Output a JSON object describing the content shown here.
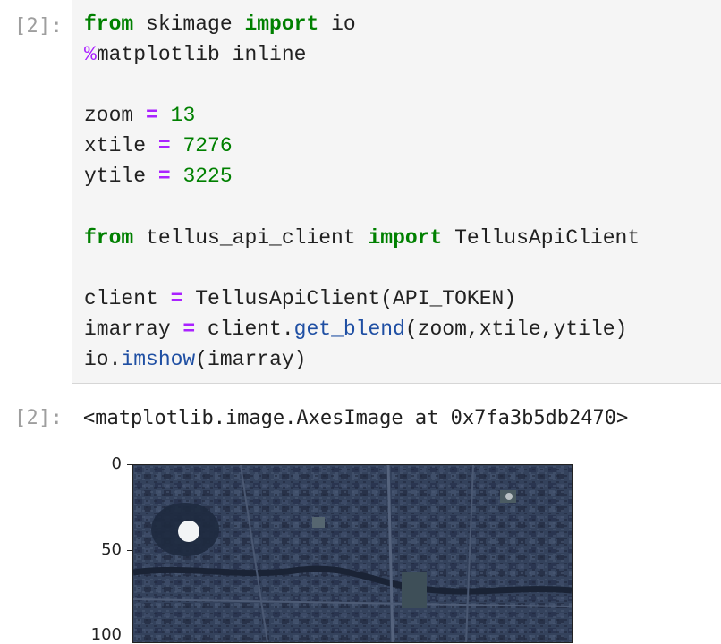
{
  "input_cell": {
    "prompt": "[2]:",
    "lines": [
      [
        {
          "t": "from",
          "c": "kw"
        },
        {
          "t": " skimage ",
          "c": ""
        },
        {
          "t": "import",
          "c": "kw"
        },
        {
          "t": " io",
          "c": ""
        }
      ],
      [
        {
          "t": "%",
          "c": "magic"
        },
        {
          "t": "matplotlib inline",
          "c": ""
        }
      ],
      [],
      [
        {
          "t": "zoom ",
          "c": ""
        },
        {
          "t": "=",
          "c": "op"
        },
        {
          "t": " ",
          "c": ""
        },
        {
          "t": "13",
          "c": "num"
        }
      ],
      [
        {
          "t": "xtile ",
          "c": ""
        },
        {
          "t": "=",
          "c": "op"
        },
        {
          "t": " ",
          "c": ""
        },
        {
          "t": "7276",
          "c": "num"
        }
      ],
      [
        {
          "t": "ytile ",
          "c": ""
        },
        {
          "t": "=",
          "c": "op"
        },
        {
          "t": " ",
          "c": ""
        },
        {
          "t": "3225",
          "c": "num"
        }
      ],
      [],
      [
        {
          "t": "from",
          "c": "kw"
        },
        {
          "t": " tellus_api_client ",
          "c": ""
        },
        {
          "t": "import",
          "c": "kw"
        },
        {
          "t": " TellusApiClient",
          "c": ""
        }
      ],
      [],
      [
        {
          "t": "client ",
          "c": ""
        },
        {
          "t": "=",
          "c": "op"
        },
        {
          "t": " TellusApiClient(API_TOKEN)",
          "c": ""
        }
      ],
      [
        {
          "t": "imarray ",
          "c": ""
        },
        {
          "t": "=",
          "c": "op"
        },
        {
          "t": " client.",
          "c": ""
        },
        {
          "t": "get_blend",
          "c": "fn"
        },
        {
          "t": "(zoom,xtile,ytile)",
          "c": ""
        }
      ],
      [
        {
          "t": "io.",
          "c": ""
        },
        {
          "t": "imshow",
          "c": "fn"
        },
        {
          "t": "(imarray)",
          "c": ""
        }
      ]
    ]
  },
  "output_cell": {
    "prompt": "[2]:",
    "repr_text": "<matplotlib.image.AxesImage at 0x7fa3b5db2470>",
    "y_ticks": [
      "0",
      "50",
      "100"
    ]
  },
  "colors": {
    "keyword": "#008000",
    "operator": "#aa22ff",
    "number": "#008000",
    "function": "#1f4fa3",
    "editor_bg": "#f5f5f5",
    "prompt": "#9e9e9e"
  }
}
